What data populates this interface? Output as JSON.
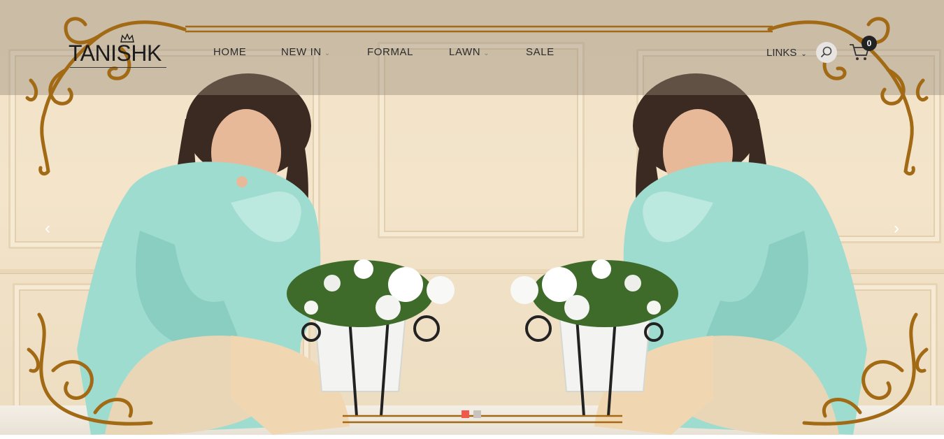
{
  "brand": {
    "name": "TANISHK"
  },
  "nav": {
    "items": [
      {
        "label": "HOME"
      },
      {
        "label": "NEW IN"
      },
      {
        "label": "FORMAL"
      },
      {
        "label": "LAWN"
      },
      {
        "label": "SALE"
      }
    ],
    "links_label": "LINKS"
  },
  "cart": {
    "count": "0"
  },
  "slider": {
    "prev_symbol": "‹",
    "next_symbol": "›",
    "active_slide": 1,
    "slide_count": 2
  },
  "colors": {
    "ornament_gold": "#a26a14",
    "active_dot": "#f05a4a",
    "inactive_dot": "#c8c3bd",
    "dress": "#9edcd0",
    "wall": "#f1e2c8"
  },
  "icons": {
    "search": "search-icon",
    "cart": "cart-icon",
    "prev": "chevron-left-icon",
    "next": "chevron-right-icon",
    "dropdown": "chevron-down-icon"
  }
}
